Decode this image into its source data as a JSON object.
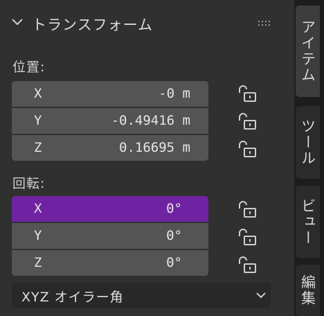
{
  "panel": {
    "title": "トランスフォーム",
    "location": {
      "label": "位置:",
      "fields": [
        {
          "axis": "X",
          "value": "-0 m"
        },
        {
          "axis": "Y",
          "value": "-0.49416 m"
        },
        {
          "axis": "Z",
          "value": "0.16695 m"
        }
      ]
    },
    "rotation": {
      "label": "回転:",
      "fields": [
        {
          "axis": "X",
          "value": "0°"
        },
        {
          "axis": "Y",
          "value": "0°"
        },
        {
          "axis": "Z",
          "value": "0°"
        }
      ],
      "mode": "XYZ オイラー角"
    }
  },
  "tabs": [
    "アイテム",
    "ツール",
    "ビュー",
    "編集"
  ],
  "colors": {
    "active_field": "#6f23a3",
    "field": "#545454",
    "panel_bg": "#303030",
    "tab_bar_bg": "#1d1d1d"
  }
}
